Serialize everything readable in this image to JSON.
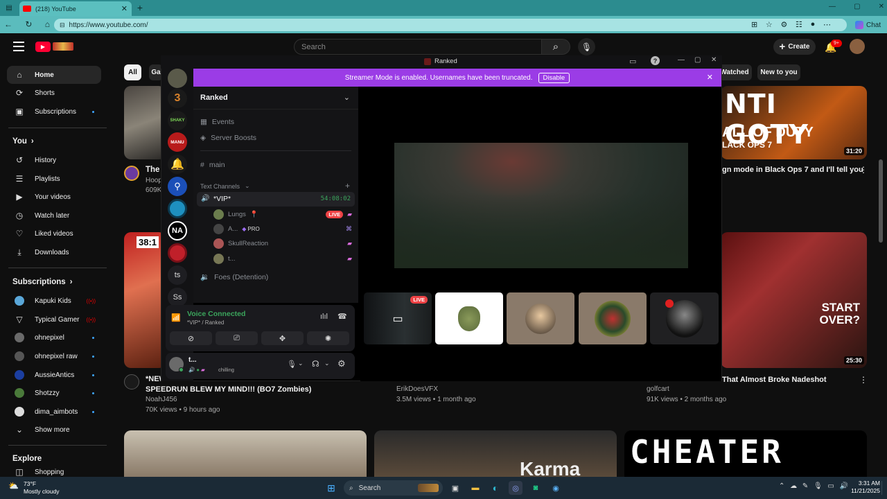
{
  "browser": {
    "tab_title": "(218) YouTube",
    "url": "https://www.youtube.com/",
    "chat_label": "Chat"
  },
  "youtube": {
    "search_placeholder": "Search",
    "create_label": "Create",
    "notif_count": "9+",
    "nav": [
      {
        "label": "Home",
        "icon": "home-icon",
        "glyph": "⌂"
      },
      {
        "label": "Shorts",
        "icon": "shorts-icon",
        "glyph": "⟳"
      },
      {
        "label": "Subscriptions",
        "icon": "subscriptions-icon",
        "glyph": "▣"
      }
    ],
    "you_header": "You",
    "you_items": [
      {
        "label": "History",
        "icon": "history-icon",
        "glyph": "↺"
      },
      {
        "label": "Playlists",
        "icon": "playlists-icon",
        "glyph": "☰"
      },
      {
        "label": "Your videos",
        "icon": "your-videos-icon",
        "glyph": "▶"
      },
      {
        "label": "Watch later",
        "icon": "watch-later-icon",
        "glyph": "◷"
      },
      {
        "label": "Liked videos",
        "icon": "liked-icon",
        "glyph": "👍"
      },
      {
        "label": "Downloads",
        "icon": "downloads-icon",
        "glyph": "⤓"
      }
    ],
    "subs_header": "Subscriptions",
    "subs": [
      {
        "label": "Kapuki Kids",
        "live": true,
        "color": "#5aa7d8"
      },
      {
        "label": "Typical Gamer",
        "live": true,
        "color": "#222"
      },
      {
        "label": "ohnepixel",
        "live": false,
        "color": "#6a6a6a"
      },
      {
        "label": "ohnepixel raw",
        "live": false,
        "color": "#555"
      },
      {
        "label": "AussieAntics",
        "live": false,
        "color": "#1b3ea0"
      },
      {
        "label": "Shotzzy",
        "live": false,
        "color": "#4a7a3a"
      },
      {
        "label": "dima_aimbots",
        "live": false,
        "color": "#ddd"
      }
    ],
    "show_more": "Show more",
    "explore_header": "Explore",
    "shopping": "Shopping",
    "chips": {
      "all": "All",
      "g": "Ga",
      "watched": "Watched",
      "new": "New to you"
    },
    "videos": {
      "v1_title": "The",
      "v1_channel": "Hoop",
      "v1_views": "609K",
      "v2_title_tail": "gn mode in Black Ops 7 and I'll tell you",
      "v2_duration": "31:20",
      "v2_thumb_text1": "NTI GOTY",
      "v2_thumb_text2": "ALL OF DUTY",
      "v2_thumb_text3": "LACK OPS 7",
      "v3_title_line1": "*NEW*",
      "v3_title_line2": "SPEEDRUN BLEW MY MIND!!! (BO7 Zombies)",
      "v3_channel": "NoahJ456",
      "v3_meta": "70K views • 9 hours ago",
      "v3_thumb_text": "38:1",
      "v4_channel": "ErikDoesVFX",
      "v4_meta": "3.5M views • 1 month ago",
      "v5_title": "That Almost Broke Nadeshot",
      "v5_channel": "golfcart",
      "v5_meta": "91K views • 2 months ago",
      "v5_duration": "25:30",
      "v5_thumb_text": "START OVER?",
      "v6_thumb_text": "Karma",
      "v7_thumb_text": "CHEATER"
    }
  },
  "discord": {
    "window_title": "Ranked",
    "banner_text": "Streamer Mode is enabled. Usernames have been truncated.",
    "banner_button": "Disable",
    "server_name": "Ranked",
    "events": "Events",
    "boosts": "Server Boosts",
    "main_channel": "main",
    "text_channels": "Text Channels",
    "vip_channel": "*VIP*",
    "vip_timer": "54:08:02",
    "voice_users": [
      {
        "name": "Lungs",
        "badge": "LIVE",
        "color": "#6b7d4d"
      },
      {
        "name": "A...",
        "badge": "PRO",
        "color": "#444"
      },
      {
        "name": "SkullReaction",
        "badge": "",
        "color": "#a55"
      },
      {
        "name": "t...",
        "badge": "",
        "color": "#775"
      }
    ],
    "foes_channel": "Foes (Detention)",
    "server_icons": [
      {
        "label": "",
        "color": "#5a5a4a"
      },
      {
        "label": "",
        "color": "#d9822b"
      },
      {
        "label": "",
        "color": "#2a5a2a"
      },
      {
        "label": "MANU",
        "color": "#b81b1b"
      },
      {
        "label": "",
        "color": "#1e6fd9"
      },
      {
        "label": "",
        "color": "#1b4fb8"
      },
      {
        "label": "",
        "color": "#1e90c0"
      },
      {
        "label": "NA",
        "color": "#000"
      },
      {
        "label": "",
        "color": "#c0202a"
      },
      {
        "label": "ts",
        "color": "#2a2a2e"
      },
      {
        "label": "Ss",
        "color": "#2a2a2e"
      }
    ],
    "voice_connected": "Voice Connected",
    "voice_sub": "*VIP* / Ranked",
    "user_name": "t...",
    "user_status": "chilling",
    "tile_live": "LIVE"
  },
  "taskbar": {
    "temp": "73°F",
    "weather": "Mostly cloudy",
    "search": "Search",
    "time": "3:31 AM",
    "date": "11/21/2025"
  }
}
